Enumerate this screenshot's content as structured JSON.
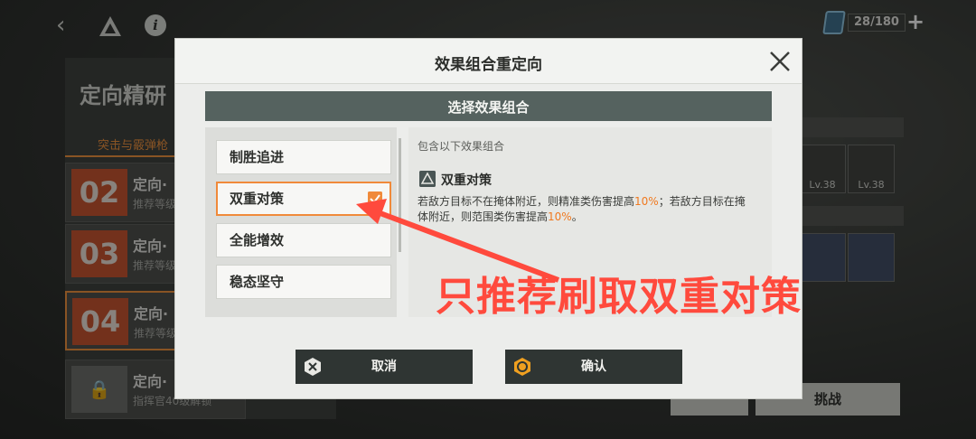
{
  "stamina": {
    "current_max": "28/180"
  },
  "background": {
    "page_title": "定向精研",
    "tab": "突击与霰弹枪",
    "stages": [
      {
        "num": "02",
        "name": "定向·",
        "sub": "推荐等级"
      },
      {
        "num": "03",
        "name": "定向·",
        "sub": "推荐等级"
      },
      {
        "num": "04",
        "name": "定向·",
        "sub": "推荐等级"
      },
      {
        "num": "",
        "name": "定向·",
        "sub": "指挥官40级解锁"
      }
    ],
    "item_levels": [
      "Lv.38",
      "Lv.38"
    ],
    "challenge_label": "挑战"
  },
  "dialog": {
    "title": "效果组合重定向",
    "section_title": "选择效果组合",
    "options": [
      {
        "label": "制胜追进",
        "selected": false
      },
      {
        "label": "双重对策",
        "selected": true
      },
      {
        "label": "全能增效",
        "selected": false
      },
      {
        "label": "稳态坚守",
        "selected": false
      }
    ],
    "detail": {
      "heading": "包含以下效果组合",
      "effect_name": "双重对策",
      "desc_part1": "若敌方目标不在掩体附近，则精准类伤害提高",
      "desc_val1": "10%",
      "desc_part2": "；若敌方目标在掩体附近，则范围类伤害提高",
      "desc_val2": "10%",
      "desc_part3": "。"
    },
    "cancel_label": "取消",
    "confirm_label": "确认"
  },
  "annotation": {
    "text": "只推荐刷取双重对策",
    "color": "#ff4a3d"
  },
  "colors": {
    "accent": "#f08a3a",
    "section_bar": "#55625f",
    "button_dark": "#2f3533"
  }
}
